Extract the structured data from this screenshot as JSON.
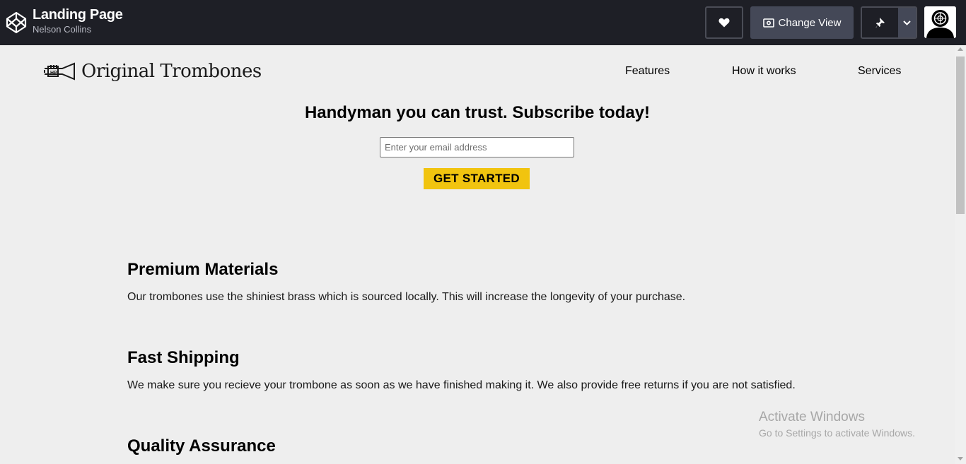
{
  "header": {
    "title": "Landing Page",
    "author": "Nelson Collins",
    "change_view_label": "Change View"
  },
  "site": {
    "logo_text": "Original Trombones",
    "nav": [
      "Features",
      "How it works",
      "Services"
    ],
    "hero_title": "Handyman you can trust. Subscribe today!",
    "email_placeholder": "Enter your email address",
    "cta_label": "GET STARTED",
    "features": [
      {
        "title": "Premium Materials",
        "text": "Our trombones use the shiniest brass which is sourced locally. This will increase the longevity of your purchase."
      },
      {
        "title": "Fast Shipping",
        "text": "We make sure you recieve your trombone as soon as we have finished making it. We also provide free returns if you are not satisfied."
      },
      {
        "title": "Quality Assurance",
        "text": ""
      }
    ]
  },
  "watermark": {
    "line1": "Activate Windows",
    "line2": "Go to Settings to activate Windows."
  },
  "colors": {
    "topbar": "#1e1f26",
    "button_dark": "#444857",
    "cta": "#f1c40f",
    "page_bg": "#eeeeee"
  },
  "icons": [
    "codepen-logo-icon",
    "heart-icon",
    "eye-icon",
    "pin-icon",
    "chevron-down-icon",
    "trumpet-logo-icon"
  ]
}
